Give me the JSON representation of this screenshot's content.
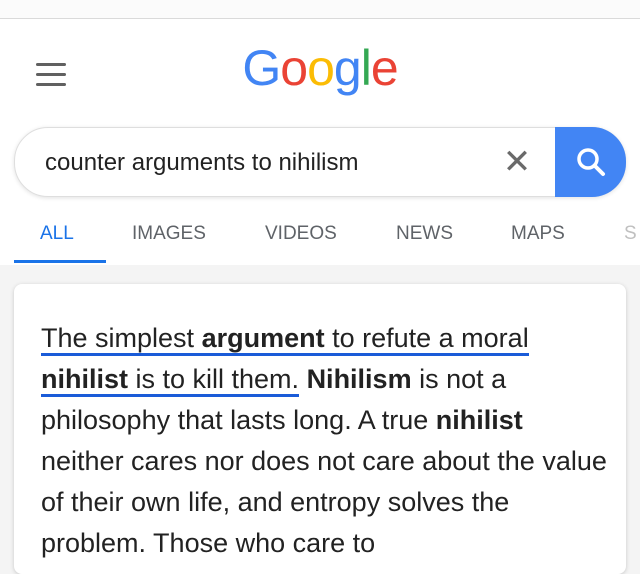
{
  "logo": {
    "letters": [
      {
        "char": "G",
        "color": "#4285f4"
      },
      {
        "char": "o",
        "color": "#ea4335"
      },
      {
        "char": "o",
        "color": "#fbbc05"
      },
      {
        "char": "g",
        "color": "#4285f4"
      },
      {
        "char": "l",
        "color": "#34a853"
      },
      {
        "char": "e",
        "color": "#ea4335"
      }
    ]
  },
  "search": {
    "value": "counter arguments to nihilism",
    "clear_symbol": "✕",
    "icons": {
      "menu": "hamburger-menu-icon",
      "clear": "close-icon",
      "search": "search-icon"
    }
  },
  "tabs": [
    {
      "label": "ALL",
      "active": true
    },
    {
      "label": "IMAGES"
    },
    {
      "label": "VIDEOS"
    },
    {
      "label": "NEWS"
    },
    {
      "label": "MAPS"
    },
    {
      "label": "S"
    }
  ],
  "snippet": {
    "parts": [
      {
        "text": "The simplest ",
        "bold": false
      },
      {
        "text": "argument",
        "bold": true
      },
      {
        "text": " to refute a moral ",
        "bold": false
      },
      {
        "text": "nihilist",
        "bold": true
      },
      {
        "text": " is to kill them.",
        "bold": false
      },
      {
        "text": " ",
        "bold": false
      },
      {
        "text": "Nihilism",
        "bold": true
      },
      {
        "text": " is not a philosophy that lasts long. A true ",
        "bold": false
      },
      {
        "text": "nihilist",
        "bold": true
      },
      {
        "text": " neither cares nor does not care about the value of their own life, and entropy solves the problem. Those who care to",
        "bold": false
      }
    ]
  },
  "colors": {
    "accent": "#1a73e8",
    "search_button": "#4285f4"
  }
}
